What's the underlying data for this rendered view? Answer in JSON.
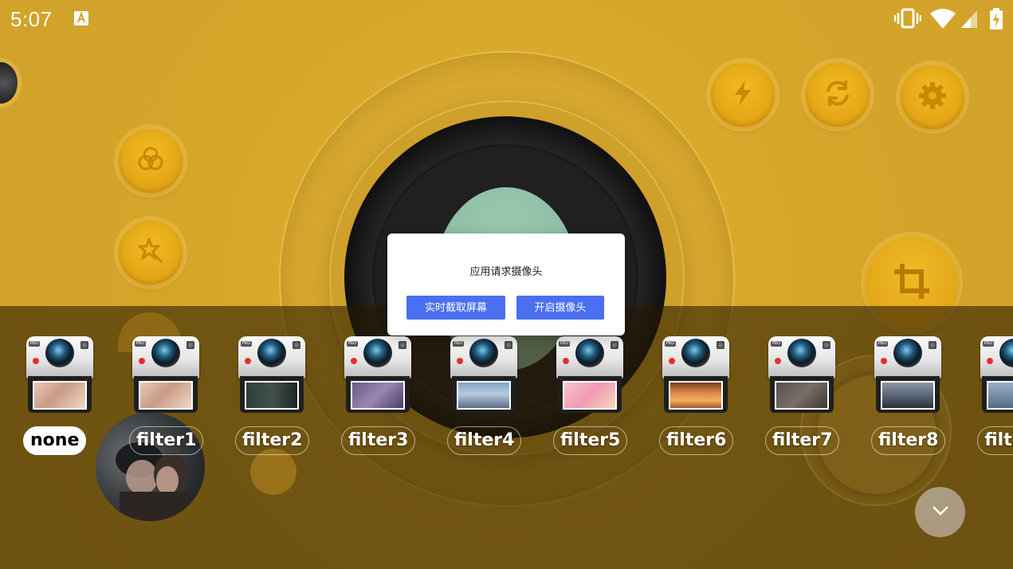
{
  "status_bar": {
    "time": "5:07",
    "icons": [
      "font-a-icon",
      "vibrate-icon",
      "wifi-icon",
      "signal-icon",
      "battery-charging-icon"
    ]
  },
  "toolbar": {
    "icons": [
      "flash-icon",
      "switch-camera-icon",
      "settings-icon",
      "color-filter-icon",
      "magic-star-icon",
      "crop-icon"
    ]
  },
  "filters": [
    {
      "label": "none",
      "active": true,
      "photo": "portrait-warm"
    },
    {
      "label": "filter1",
      "active": false,
      "photo": "portrait-warm"
    },
    {
      "label": "filter2",
      "active": false,
      "photo": "portrait-dark"
    },
    {
      "label": "filter3",
      "active": false,
      "photo": "portrait-purple"
    },
    {
      "label": "filter4",
      "active": false,
      "photo": "window-blue"
    },
    {
      "label": "filter5",
      "active": false,
      "photo": "pink-haze"
    },
    {
      "label": "filter6",
      "active": false,
      "photo": "station-orange"
    },
    {
      "label": "filter7",
      "active": false,
      "photo": "hand-grey"
    },
    {
      "label": "filter8",
      "active": false,
      "photo": "building-grey"
    },
    {
      "label": "filte",
      "active": false,
      "photo": "street-blue"
    }
  ],
  "dialog": {
    "title": "应用请求摄像头",
    "button_screen_capture": "实时截取屏幕",
    "button_open_camera": "开启摄像头"
  },
  "colors": {
    "background": "#D4A52A",
    "dialog_button": "#4A6FF0",
    "active_filter_bg": "#FFFFFF"
  }
}
